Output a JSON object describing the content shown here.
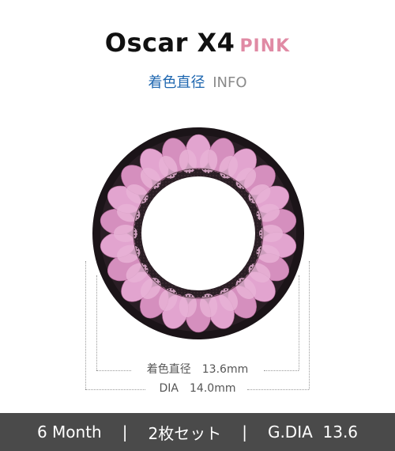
{
  "product": {
    "name": "Oscar X4",
    "color": "PINK"
  },
  "subtitle": {
    "jp": "着色直径",
    "en": "INFO"
  },
  "dimensions": {
    "colored_label": "着色直径",
    "colored_value": "13.6mm",
    "dia_label": "DIA",
    "dia_value": "14.0mm"
  },
  "footer": {
    "period": "6 Month",
    "separator": "|",
    "quantity": "2枚セット",
    "gdia": "G.DIA  13.6"
  },
  "colors": {
    "accent_pink": "#e08aa4",
    "accent_blue": "#1f67b0",
    "footer_bg": "#4a4a4a"
  }
}
